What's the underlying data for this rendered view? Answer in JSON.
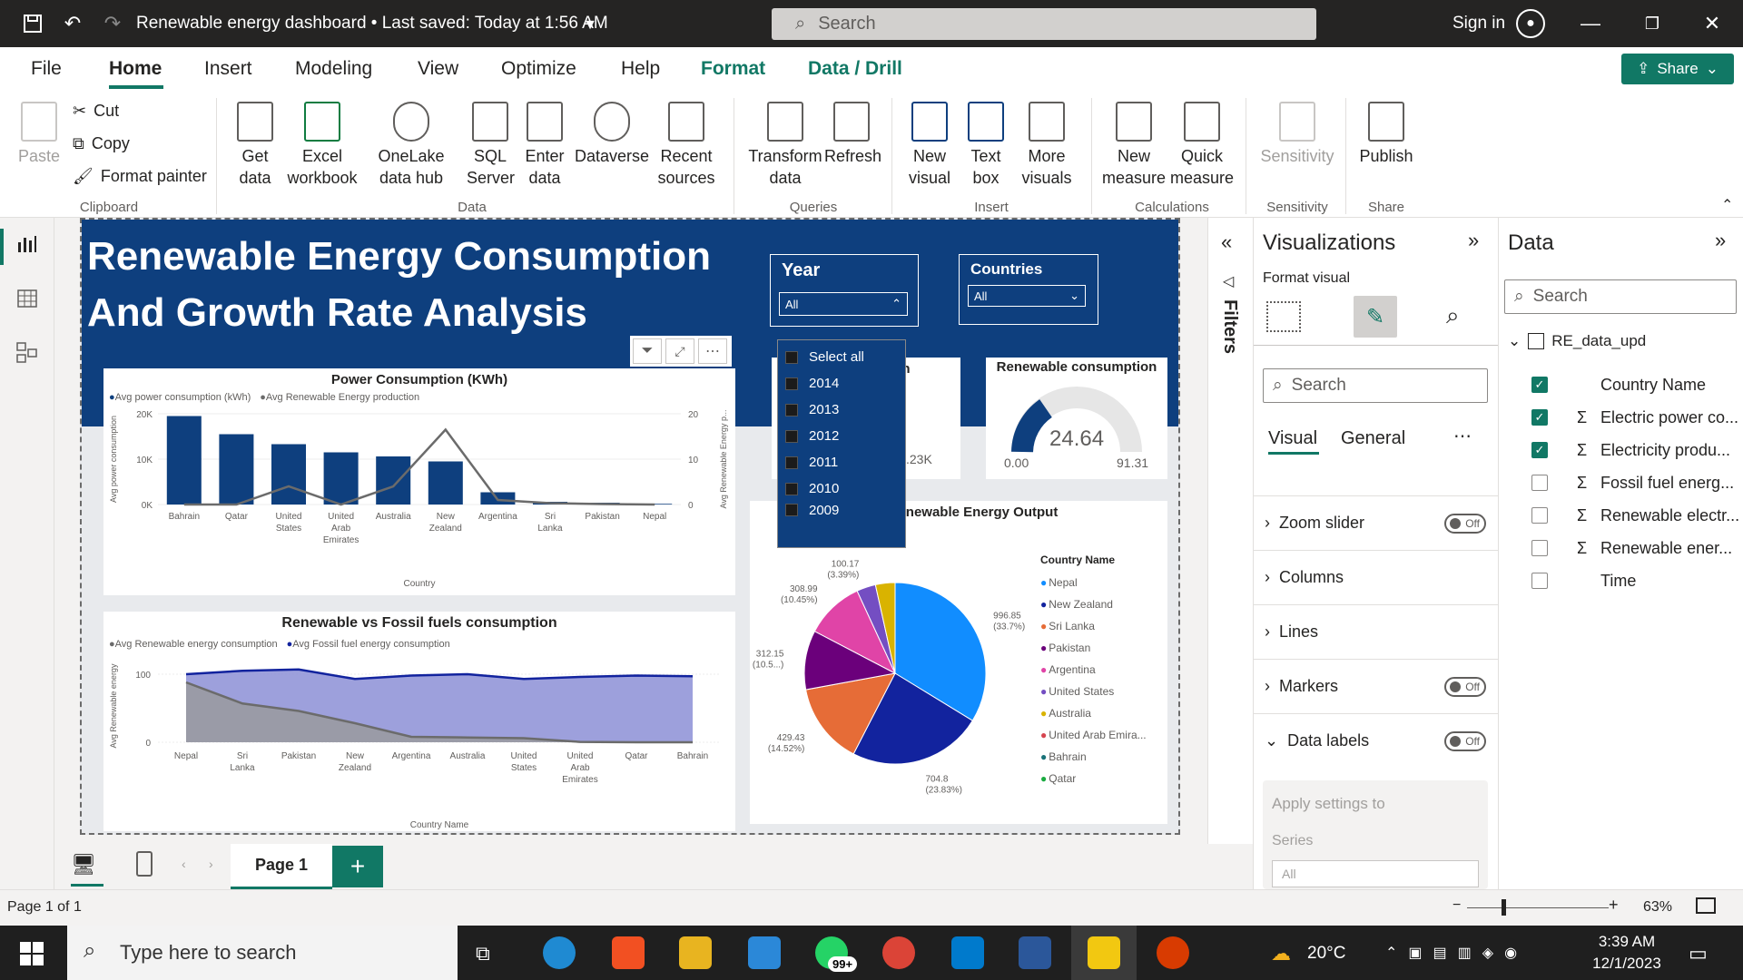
{
  "titlebar": {
    "doc_title": "Renewable energy dashboard • Last saved: Today at 1:56 AM",
    "search_placeholder": "Search",
    "sign_in": "Sign in"
  },
  "menu": {
    "items": [
      "File",
      "Home",
      "Insert",
      "Modeling",
      "View",
      "Optimize",
      "Help",
      "Format",
      "Data / Drill"
    ],
    "share": "Share"
  },
  "ribbon": {
    "clipboard": {
      "paste": "Paste",
      "cut": "Cut",
      "copy": "Copy",
      "format_painter": "Format painter",
      "group": "Clipboard"
    },
    "data": {
      "get_data": "Get data",
      "excel": "Excel workbook",
      "onelake": "OneLake data hub",
      "sql": "SQL Server",
      "enter": "Enter data",
      "dataverse": "Dataverse",
      "recent": "Recent sources",
      "group": "Data"
    },
    "queries": {
      "transform": "Transform data",
      "refresh": "Refresh",
      "group": "Queries"
    },
    "insert": {
      "new_visual": "New visual",
      "text_box": "Text box",
      "more_visuals": "More visuals",
      "group": "Insert"
    },
    "calculations": {
      "new_measure": "New measure",
      "quick_measure": "Quick measure",
      "group": "Calculations"
    },
    "sensitivity": {
      "label": "Sensitivity",
      "group": "Sensitivity"
    },
    "share": {
      "publish": "Publish",
      "group": "Share"
    }
  },
  "report": {
    "title_line1": "Renewable Energy Consumption",
    "title_line2": "And Growth Rate Analysis",
    "year_slicer": {
      "title": "Year",
      "value": "All",
      "options": [
        "Select all",
        "2014",
        "2013",
        "2012",
        "2011",
        "2010",
        "2009"
      ]
    },
    "country_slicer": {
      "title": "Countries",
      "value": "All"
    },
    "hidden_card_fragment": "ion",
    "hidden_card_value": ".23K",
    "gauge": {
      "title": "Renewable consumption",
      "value": "24.64",
      "min": "0.00",
      "max": "91.31"
    }
  },
  "chart_data": [
    {
      "type": "bar",
      "title": "Power Consumption (KWh)",
      "legend": [
        "Avg power consumption (kWh)",
        "Avg Renewable Energy production"
      ],
      "categories": [
        "Bahrain",
        "Qatar",
        "United States",
        "United Arab Emirates",
        "Australia",
        "New Zealand",
        "Argentina",
        "Sri Lanka",
        "Pakistan",
        "Nepal"
      ],
      "series": [
        {
          "name": "Avg power consumption (kWh)",
          "values": [
            19500,
            15500,
            13300,
            11500,
            10600,
            9500,
            2700,
            600,
            400,
            150
          ]
        },
        {
          "name": "Avg Renewable Energy production",
          "values": [
            0,
            0,
            4,
            0,
            4,
            16.5,
            1,
            0.3,
            0.1,
            0
          ]
        }
      ],
      "xlabel": "Country",
      "ylabel": "Avg power consumption",
      "y2label": "Avg Renewable Energy p...",
      "yticks": [
        "20K",
        "10K",
        "0K"
      ],
      "y2ticks": [
        "20",
        "10",
        "0"
      ],
      "ylim": [
        0,
        20000
      ],
      "y2lim": [
        0,
        20
      ]
    },
    {
      "type": "area",
      "title": "Renewable vs Fossil fuels consumption",
      "legend": [
        "Avg Renewable energy consumption",
        "Avg Fossil fuel energy consumption"
      ],
      "categories": [
        "Nepal",
        "Sri Lanka",
        "Pakistan",
        "New Zealand",
        "Argentina",
        "Australia",
        "United States",
        "United Arab Emirates",
        "Qatar",
        "Bahrain"
      ],
      "series": [
        {
          "name": "Avg Renewable energy consumption",
          "values": [
            88,
            57,
            46,
            28,
            8,
            7,
            6,
            0.5,
            0,
            0
          ]
        },
        {
          "name": "Avg Fossil fuel energy consumption",
          "values": [
            100,
            105,
            107,
            93,
            98,
            100,
            93,
            96,
            98,
            97
          ]
        }
      ],
      "xlabel": "Country Name",
      "ylabel": "Avg Renewable energy",
      "yticks": [
        "100",
        "0"
      ],
      "ylim": [
        0,
        120
      ]
    },
    {
      "type": "pie",
      "title": "Avg Renewable Energy Output",
      "legend_title": "Country Name",
      "legend": [
        "Nepal",
        "New Zealand",
        "Sri Lanka",
        "Pakistan",
        "Argentina",
        "United States",
        "Australia",
        "United Arab Emira...",
        "Bahrain",
        "Qatar"
      ],
      "slices": [
        {
          "name": "Nepal",
          "value": 996.85,
          "label": "996.85 (33.7%)",
          "color": "#118dff"
        },
        {
          "name": "New Zealand",
          "value": 704.8,
          "label": "704.8 (23.83%)",
          "color": "#12239e"
        },
        {
          "name": "Sri Lanka",
          "value": 429.43,
          "label": "429.43 (14.52%)",
          "color": "#e66c37"
        },
        {
          "name": "Pakistan",
          "value": 312.15,
          "label": "312.15 (10.5...)",
          "color": "#6b007b"
        },
        {
          "name": "Argentina",
          "value": 308.99,
          "label": "308.99 (10.45%)",
          "color": "#e044a7"
        },
        {
          "name": "United States",
          "value": 100.17,
          "label": "100.17 (3.39%)",
          "color": "#744ec2"
        },
        {
          "name": "Australia",
          "value": 103,
          "label": "",
          "color": "#d9b300"
        }
      ]
    }
  ],
  "legend_colors": {
    "Nepal": "#118dff",
    "New Zealand": "#12239e",
    "Sri Lanka": "#e66c37",
    "Pakistan": "#6b007b",
    "Argentina": "#e044a7",
    "United States": "#744ec2",
    "Australia": "#d9b300",
    "United Arab Emira...": "#d64550",
    "Bahrain": "#197278",
    "Qatar": "#1aab40"
  },
  "filters_label": "Filters",
  "viz_pane": {
    "title": "Visualizations",
    "format_visual": "Format visual",
    "search": "Search",
    "tabs": [
      "Visual",
      "General"
    ],
    "sections": [
      {
        "label": "Zoom slider",
        "toggle": "Off"
      },
      {
        "label": "Columns",
        "toggle": ""
      },
      {
        "label": "Lines",
        "toggle": ""
      },
      {
        "label": "Markers",
        "toggle": "Off"
      },
      {
        "label": "Data labels",
        "toggle": "Off"
      }
    ],
    "apply_settings": "Apply settings to",
    "series_label": "Series",
    "series_value": "All"
  },
  "data_pane": {
    "title": "Data",
    "search": "Search",
    "table": "RE_data_upd",
    "fields": [
      {
        "name": "Country Name",
        "checked": true,
        "sigma": false
      },
      {
        "name": "Electric power co...",
        "checked": true,
        "sigma": true
      },
      {
        "name": "Electricity produ...",
        "checked": true,
        "sigma": true
      },
      {
        "name": "Fossil fuel energ...",
        "checked": false,
        "sigma": true
      },
      {
        "name": "Renewable electr...",
        "checked": false,
        "sigma": true
      },
      {
        "name": "Renewable ener...",
        "checked": false,
        "sigma": true
      },
      {
        "name": "Time",
        "checked": false,
        "sigma": false
      }
    ]
  },
  "pagebar": {
    "page": "Page 1",
    "add": "+"
  },
  "status": {
    "page_of": "Page 1 of 1",
    "zoom": "63%"
  },
  "taskbar": {
    "search": "Type here to search",
    "temp": "20°C",
    "time": "3:39 AM",
    "date": "12/1/2023",
    "badge": "99+"
  },
  "accent": "#117865",
  "brand_blue": "#0e3f7e"
}
